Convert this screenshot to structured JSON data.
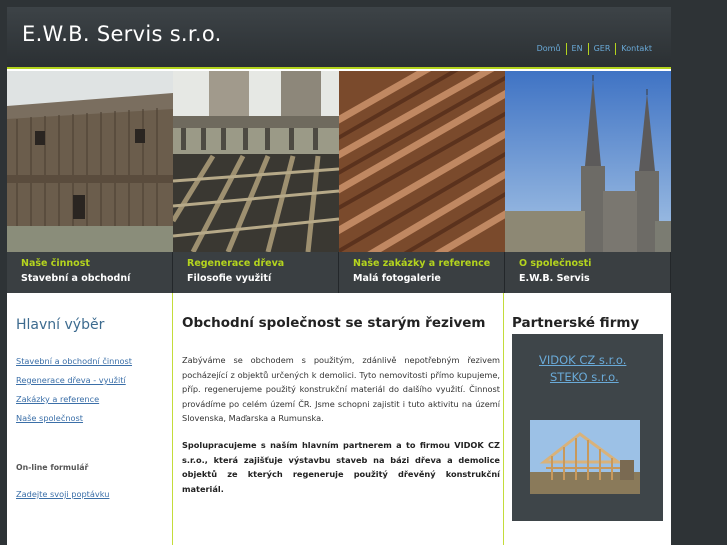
{
  "header": {
    "title": "E.W.B. Servis s.r.o.",
    "nav": [
      "Domů",
      "EN",
      "GER",
      "Kontakt"
    ]
  },
  "banner": [
    {
      "title": "Naše činnost",
      "sub": "Stavební a obchodní"
    },
    {
      "title": "Regenerace dřeva",
      "sub": "Filosofie využití"
    },
    {
      "title": "Naše zakázky a reference",
      "sub": "Malá fotogalerie"
    },
    {
      "title": "O společnosti",
      "sub": "E.W.B. Servis"
    }
  ],
  "sidebar": {
    "heading": "Hlavní výběr",
    "items": [
      "Stavební a obchodní činnost",
      "Regenerace dřeva - využití",
      "Zakázky a reference",
      "Naše společnost"
    ],
    "form_label": "On-line formulář",
    "form_link": "Zadejte svoji poptávku"
  },
  "main": {
    "title": "Obchodní společnost se starým řezivem",
    "paragraph1": "Zabýváme se obchodem s použitým, zdánlivě nepotřebným řezivem pocházející z objektů určených k demolici. Tyto nemovitosti přímo kupujeme, příp. regenerujeme použitý konstrukční materiál do dalšího využití. Činnost provádíme po celém území ČR. Jsme schopni zajistit i tuto aktivitu na území Slovenska, Maďarska a Rumunska.",
    "paragraph2": "Spolupracujeme s naším hlavním partnerem a to firmou VIDOK CZ s.r.o., která zajišťuje výstavbu staveb na bázi dřeva a demolice objektů ze kterých regeneruje použitý dřevěný konstrukční materiál."
  },
  "partners": {
    "heading": "Partnerské firmy",
    "links": [
      "VIDOK CZ s.r.o.",
      "STEKO s.r.o."
    ]
  },
  "colors": {
    "accent": "#b4d41e",
    "link": "#3b6fa8",
    "header_bg": "#3d4347"
  }
}
